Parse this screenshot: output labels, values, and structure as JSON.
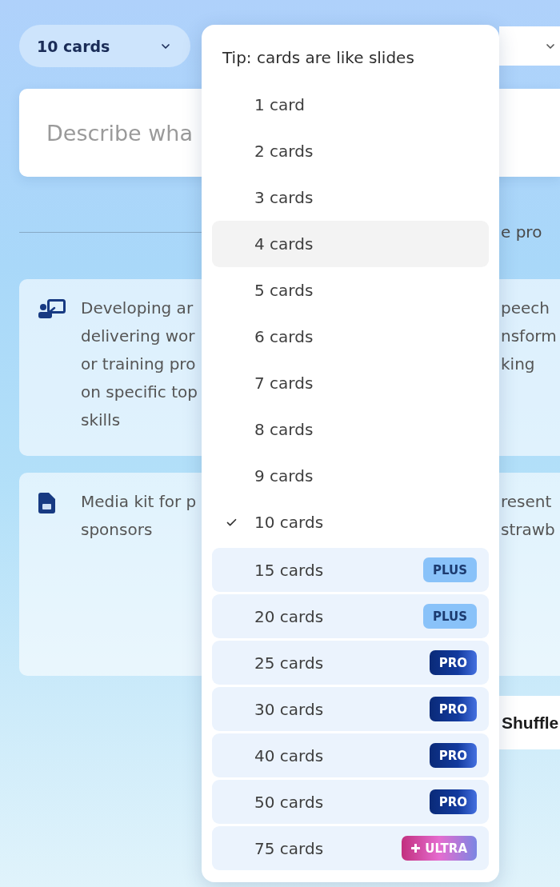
{
  "card_count_select": {
    "value": "10 cards",
    "open": true
  },
  "prompt": {
    "placeholder": "Describe wha"
  },
  "examples_divider": {
    "label": "e pro"
  },
  "example_rows": [
    {
      "cards": [
        {
          "kind": "presentation",
          "lines": [
            "Developing ar",
            "delivering wor",
            "or training pro",
            "on specific top",
            "skills"
          ]
        },
        {
          "kind": "plain",
          "lines": [
            "peech",
            "nsform",
            "king"
          ]
        }
      ]
    },
    {
      "cards": [
        {
          "kind": "document",
          "lines": [
            "Media kit for p",
            "sponsors"
          ]
        },
        {
          "kind": "plain",
          "lines": [
            "resent",
            "strawb"
          ]
        }
      ]
    }
  ],
  "shuffle_button": {
    "label": "Shuffle"
  },
  "dropdown": {
    "tip": "Tip: cards are like slides",
    "options": [
      {
        "label": "1 card",
        "selected": false,
        "hovered": false
      },
      {
        "label": "2 cards",
        "selected": false,
        "hovered": false
      },
      {
        "label": "3 cards",
        "selected": false,
        "hovered": false
      },
      {
        "label": "4 cards",
        "selected": false,
        "hovered": true
      },
      {
        "label": "5 cards",
        "selected": false,
        "hovered": false
      },
      {
        "label": "6 cards",
        "selected": false,
        "hovered": false
      },
      {
        "label": "7 cards",
        "selected": false,
        "hovered": false
      },
      {
        "label": "8 cards",
        "selected": false,
        "hovered": false
      },
      {
        "label": "9 cards",
        "selected": false,
        "hovered": false
      },
      {
        "label": "10 cards",
        "selected": true,
        "hovered": false
      },
      {
        "label": "15 cards",
        "selected": false,
        "hovered": false,
        "badge": {
          "kind": "plus",
          "label": "PLUS"
        }
      },
      {
        "label": "20 cards",
        "selected": false,
        "hovered": false,
        "badge": {
          "kind": "plus",
          "label": "PLUS"
        }
      },
      {
        "label": "25 cards",
        "selected": false,
        "hovered": false,
        "badge": {
          "kind": "pro",
          "label": "PRO"
        }
      },
      {
        "label": "30 cards",
        "selected": false,
        "hovered": false,
        "badge": {
          "kind": "pro",
          "label": "PRO"
        }
      },
      {
        "label": "40 cards",
        "selected": false,
        "hovered": false,
        "badge": {
          "kind": "pro",
          "label": "PRO"
        }
      },
      {
        "label": "50 cards",
        "selected": false,
        "hovered": false,
        "badge": {
          "kind": "pro",
          "label": "PRO"
        }
      },
      {
        "label": "75 cards",
        "selected": false,
        "hovered": false,
        "badge": {
          "kind": "ultra",
          "label": "ULTRA"
        }
      }
    ]
  }
}
